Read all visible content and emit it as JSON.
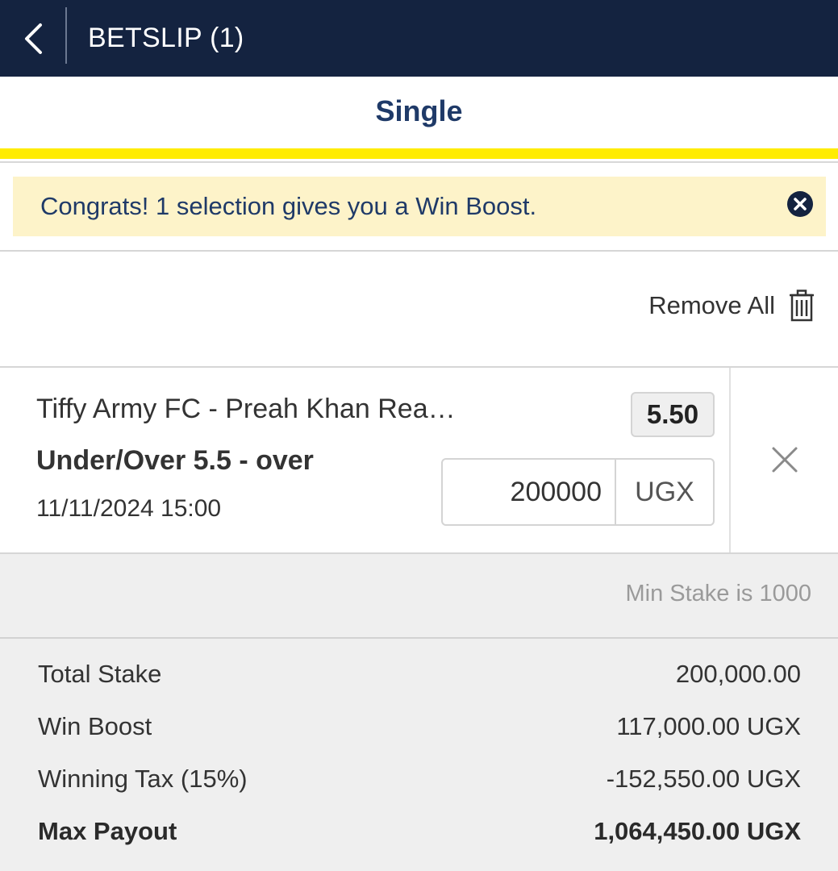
{
  "header": {
    "title": "BETSLIP (1)",
    "back_icon": "chevron-left-icon"
  },
  "tabs": [
    {
      "label": "Single",
      "active": true
    }
  ],
  "notice": {
    "text": "Congrats! 1 selection gives you a Win Boost.",
    "close_icon": "close-circle-icon"
  },
  "remove_all": {
    "label": "Remove All",
    "icon": "trash-icon"
  },
  "selection": {
    "event": "Tiffy Army FC  -  Preah Khan Rea…",
    "market": "Under/Over 5.5 - over",
    "datetime": "11/11/2024 15:00",
    "odds": "5.50",
    "stake": "200000",
    "currency": "UGX",
    "remove_icon": "close-icon"
  },
  "min_stake": "Min Stake is 1000",
  "summary": [
    {
      "label": "Total Stake",
      "value": "200,000.00"
    },
    {
      "label": "Win Boost",
      "value": "117,000.00 UGX"
    },
    {
      "label": "Winning Tax (15%)",
      "value": "-152,550.00 UGX"
    },
    {
      "label": "Max Payout",
      "value": "1,064,450.00 UGX"
    }
  ],
  "colors": {
    "header_bg": "#142340",
    "accent_text": "#1f3a68",
    "tab_indicator": "#ffec00",
    "notice_bg": "#fdf3c9",
    "summary_bg": "#efefef"
  }
}
